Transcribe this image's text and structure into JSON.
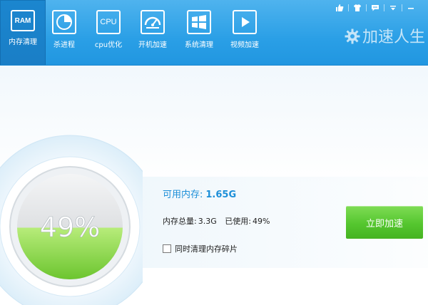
{
  "toolbar": {
    "items": [
      {
        "label": "内存清理",
        "icon": "ram-icon",
        "icon_text": "RAM",
        "active": true
      },
      {
        "label": "杀进程",
        "icon": "pie-chart-icon",
        "active": false
      },
      {
        "label": "cpu优化",
        "icon": "cpu-icon",
        "icon_text": "CPU",
        "active": false
      },
      {
        "label": "开机加速",
        "icon": "speedometer-icon",
        "active": false
      },
      {
        "label": "系统清理",
        "icon": "windows-logo-icon",
        "active": false
      },
      {
        "label": "视频加速",
        "icon": "play-icon",
        "active": false
      }
    ],
    "window_icons": [
      "thumbs-up-icon",
      "shirt-icon",
      "chat-icon",
      "dropdown-icon",
      "minimize-icon"
    ],
    "brand": {
      "logo": "gear-icon",
      "text": "加速人生"
    }
  },
  "memory": {
    "percent": "49%",
    "percent_value": 0.49,
    "available_label": "可用内存:",
    "available_value": "1.65G",
    "total_label": "内存总量:",
    "total_value": "3.3G",
    "used_label": "已使用:",
    "used_value": "49%",
    "defrag_label": "同时清理内存碎片",
    "defrag_checked": false
  },
  "actions": {
    "speedup_label": "立即加速"
  },
  "colors": {
    "toolbar": "#2a9fe6",
    "accent": "#1d8fd8",
    "button": "#55c62f",
    "gauge_fill": "#8fd64a"
  }
}
